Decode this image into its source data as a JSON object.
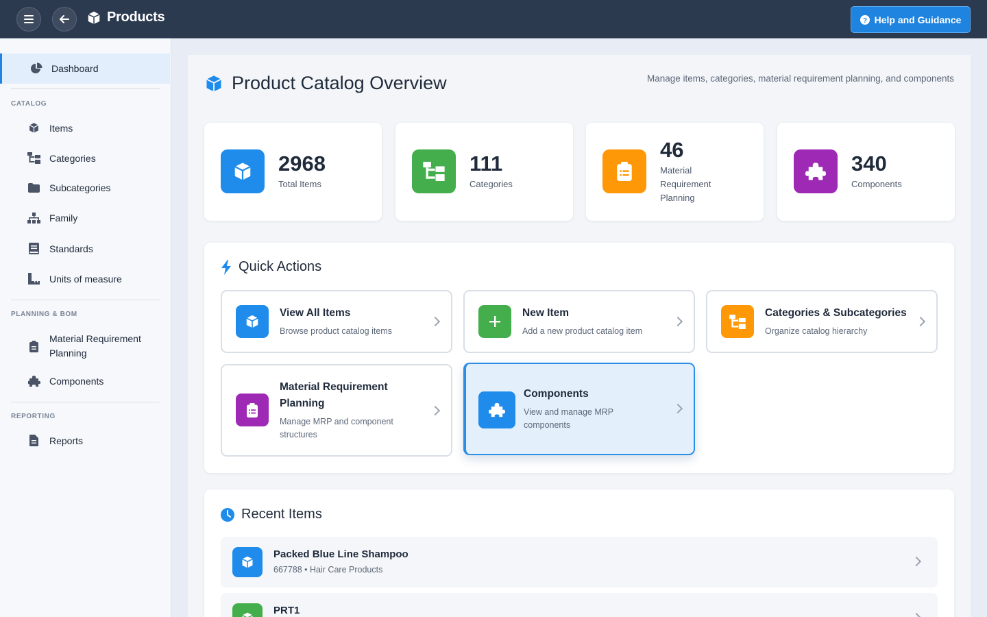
{
  "topbar": {
    "menu_icon": "hamburger-icon",
    "back_icon": "arrow-left-icon",
    "app_icon": "box-icon",
    "title": "Products",
    "help_label": "Help and Guidance",
    "help_icon": "question-circle-icon"
  },
  "sidebar": {
    "dashboard": "Dashboard",
    "sections": {
      "catalog": "CATALOG",
      "planning": "PLANNING & BOM",
      "reporting": "REPORTING"
    },
    "catalog_items": [
      {
        "label": "Items",
        "icon": "box-icon"
      },
      {
        "label": "Categories",
        "icon": "sitemap-icon"
      },
      {
        "label": "Subcategories",
        "icon": "folder-icon"
      },
      {
        "label": "Family",
        "icon": "hierarchy-icon"
      },
      {
        "label": "Standards",
        "icon": "book-icon"
      },
      {
        "label": "Units of measure",
        "icon": "ruler-icon"
      }
    ],
    "planning_items": [
      {
        "label_line1": "Material Requirement",
        "label_line2": "Planning",
        "icon": "clipboard-icon"
      },
      {
        "label": "Components",
        "icon": "puzzle-icon"
      }
    ],
    "reporting_items": [
      {
        "label": "Reports",
        "icon": "document-icon"
      }
    ]
  },
  "main": {
    "title": "Product Catalog Overview",
    "subtitle": "Manage items, categories, material requirement planning, and components",
    "stats": [
      {
        "value": "2968",
        "label": "Total Items",
        "icon": "box-icon",
        "color": "#1f8ceb"
      },
      {
        "value": "111",
        "label": "Categories",
        "icon": "sitemap-icon",
        "color": "#43ae4b"
      },
      {
        "value": "46",
        "label_lines": [
          "Material",
          "Requirement",
          "Planning"
        ],
        "icon": "clipboard-icon",
        "color": "#ff9807"
      },
      {
        "value": "340",
        "label": "Components",
        "icon": "puzzle-icon",
        "color": "#9e29b5"
      }
    ],
    "quick_actions": {
      "title": "Quick Actions",
      "items": [
        {
          "title": "View All Items",
          "desc": "Browse product catalog items",
          "icon": "box-icon"
        },
        {
          "title": "New Item",
          "desc": "Add a new product catalog item",
          "icon": "plus-icon"
        },
        {
          "title": "Categories & Subcategories",
          "desc": "Organize catalog hierarchy",
          "icon": "sitemap-icon"
        },
        {
          "title_line1": "Material Requirement",
          "title_line2": "Planning",
          "desc_line1": "Manage MRP and component",
          "desc_line2": "structures",
          "icon": "clipboard-icon"
        },
        {
          "title": "Components",
          "desc_line1": "View and manage MRP",
          "desc_line2": "components",
          "icon": "puzzle-icon"
        }
      ]
    },
    "recent": {
      "title": "Recent Items",
      "items": [
        {
          "name": "Packed Blue Line Shampoo",
          "meta": "667788 • Hair Care Products",
          "icon": "box-icon"
        },
        {
          "name": "PRT1",
          "icon": "box-icon"
        }
      ]
    }
  }
}
